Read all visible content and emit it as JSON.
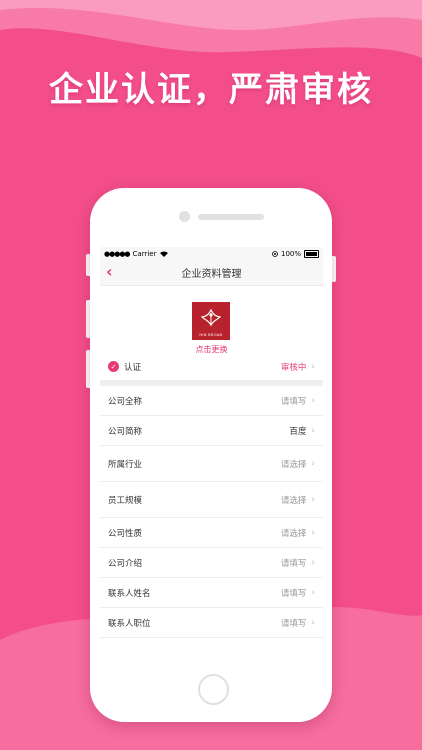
{
  "headline": "企业认证，严肃审核",
  "colors": {
    "background": "#f34e8a",
    "wave": "#f77aa7",
    "accent": "#e83a7a"
  },
  "status_bar": {
    "carrier": "Carrier",
    "battery": "100%"
  },
  "nav": {
    "back_icon": "chevron-left-icon",
    "title": "企业资料管理"
  },
  "logo": {
    "brand_text": "HIN BROAD",
    "change_label": "点击更换"
  },
  "certification": {
    "label": "认证",
    "status": "审核中"
  },
  "fields": [
    {
      "label": "公司全称",
      "value": "请填写"
    },
    {
      "label": "公司简称",
      "value": "百度"
    },
    {
      "label": "所属行业",
      "value": "请选择"
    },
    {
      "label": "员工规模",
      "value": "请选择"
    },
    {
      "label": "公司性质",
      "value": "请选择"
    },
    {
      "label": "公司介绍",
      "value": "请填写"
    },
    {
      "label": "联系人姓名",
      "value": "请填写"
    },
    {
      "label": "联系人职位",
      "value": "请填写"
    }
  ]
}
